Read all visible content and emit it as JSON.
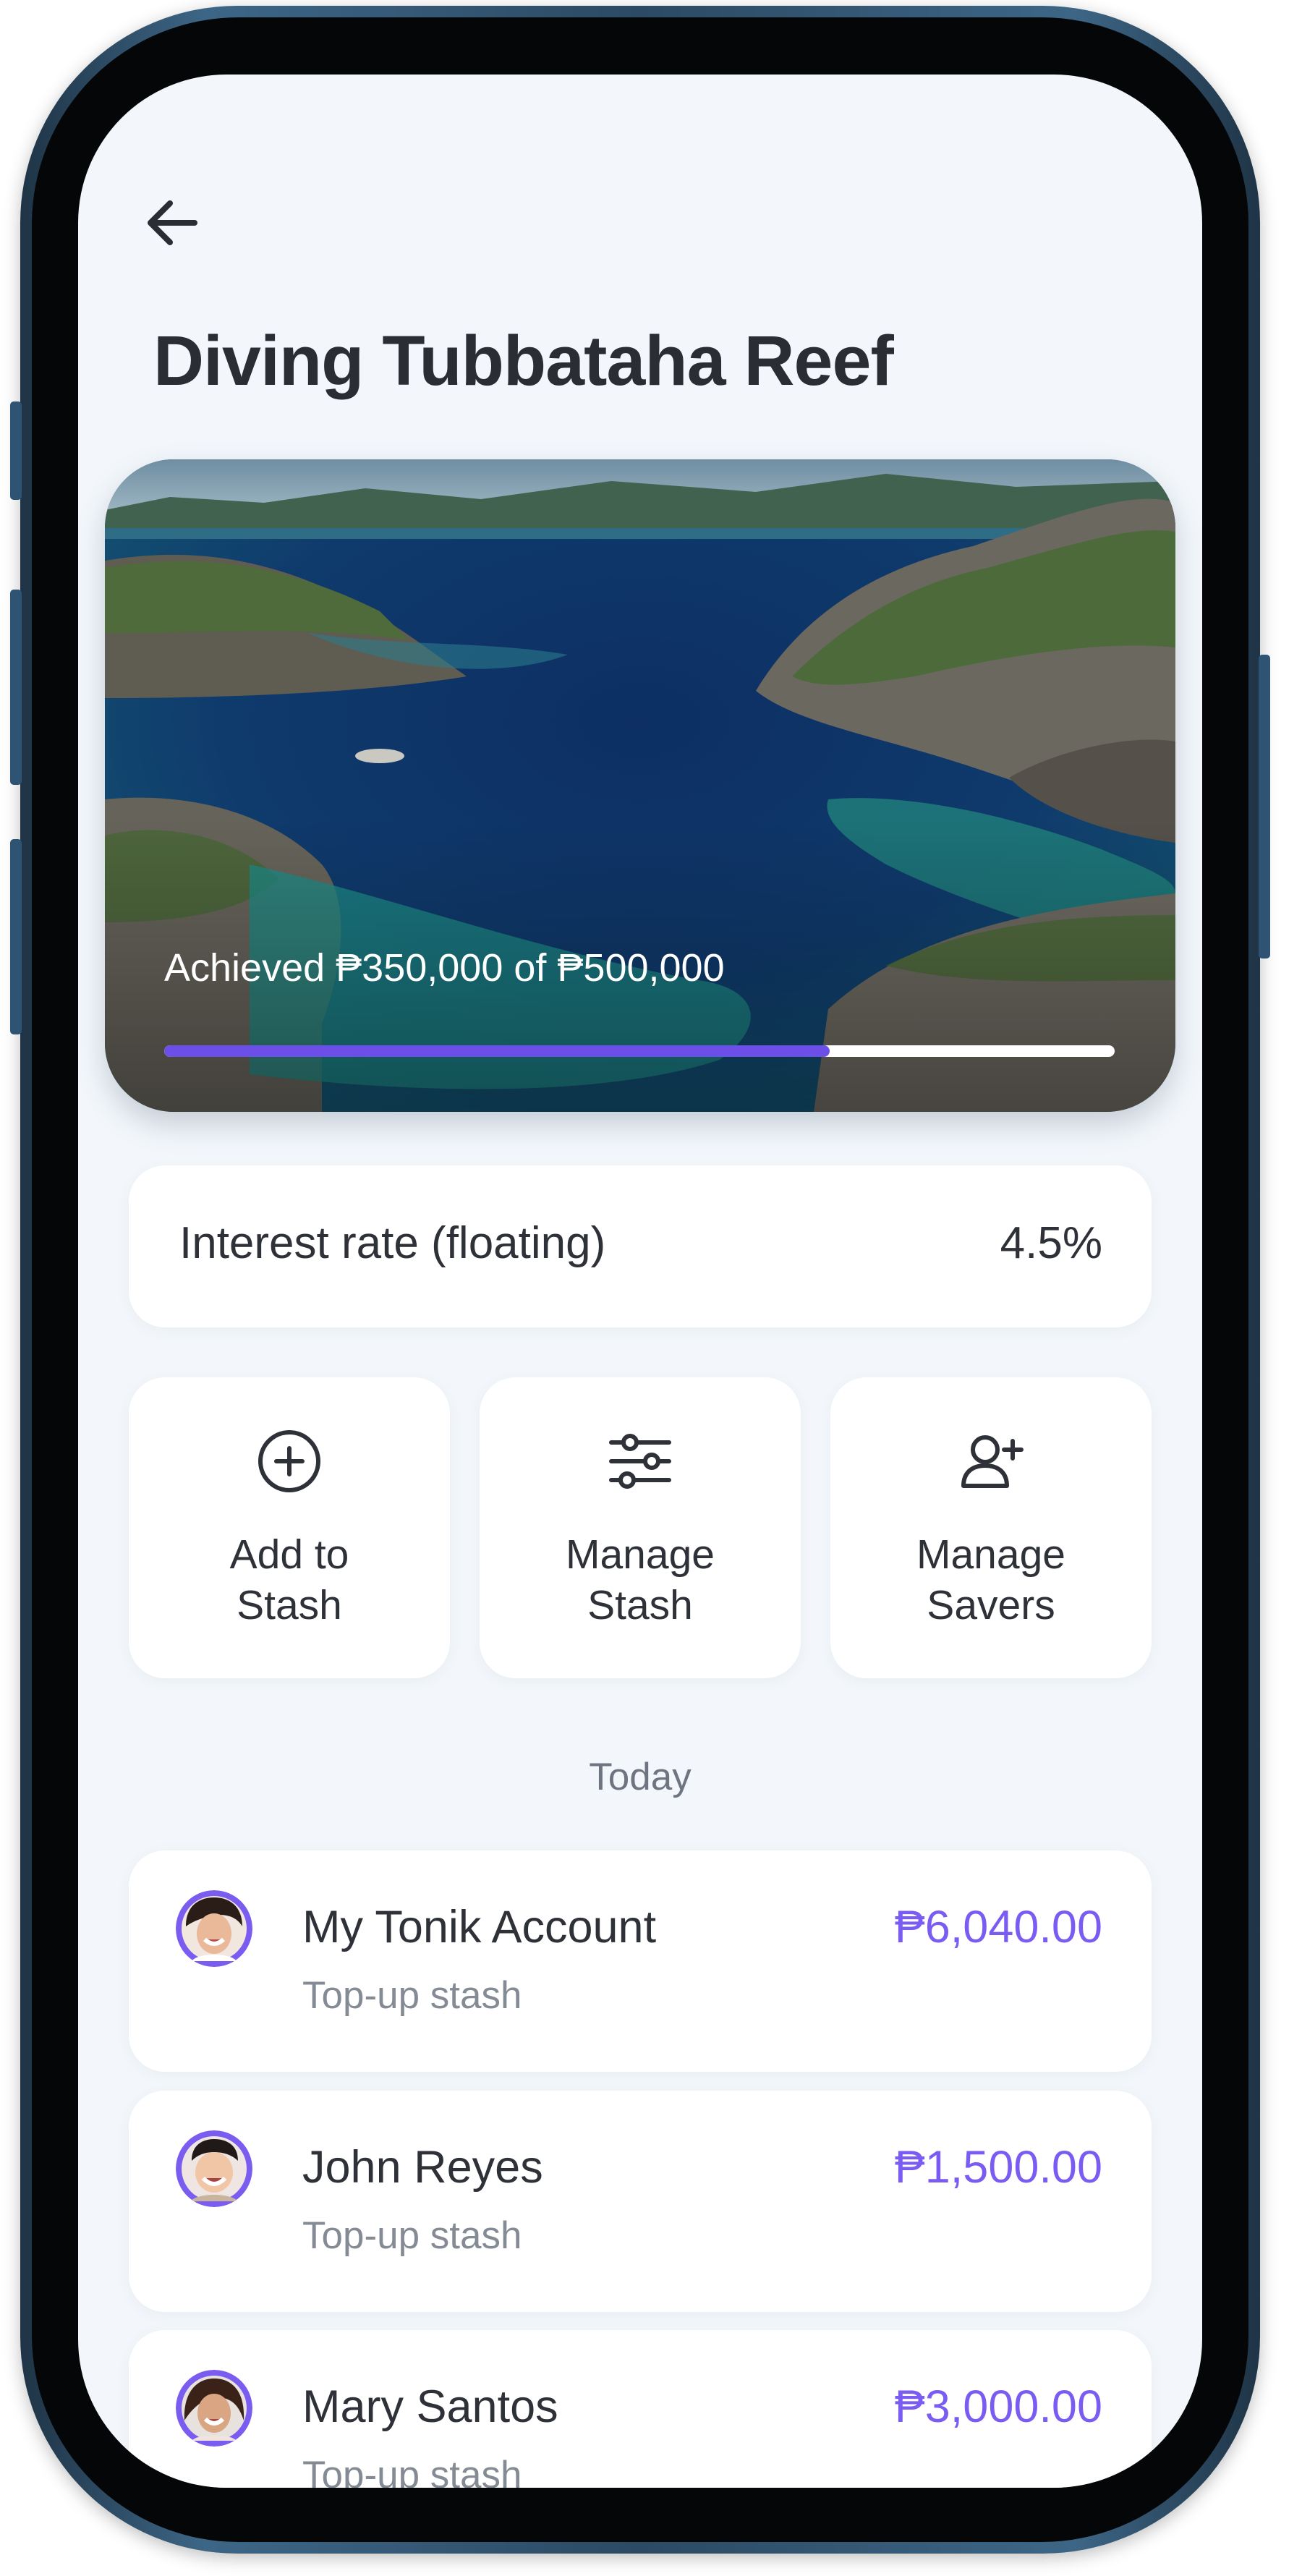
{
  "header": {
    "back_icon": "arrow-left-icon",
    "title": "Diving Tubbataha Reef"
  },
  "goal": {
    "progress_text": "Achieved ₱350,000 of ₱500,000",
    "achieved": 350000,
    "target": 500000,
    "progress_fraction": 0.7,
    "accent_color": "#6b4fe8"
  },
  "interest": {
    "label": "Interest rate (floating)",
    "value": "4.5%"
  },
  "actions": [
    {
      "label": "Add to\nStash",
      "icon": "plus-circle-icon"
    },
    {
      "label": "Manage\nStash",
      "icon": "sliders-icon"
    },
    {
      "label": "Manage\nSavers",
      "icon": "user-plus-icon"
    }
  ],
  "section_label": "Today",
  "transactions": [
    {
      "name": "My Tonik Account",
      "subtitle": "Top-up stash",
      "amount": "₱6,040.00"
    },
    {
      "name": "John Reyes",
      "subtitle": "Top-up stash",
      "amount": "₱1,500.00"
    },
    {
      "name": "Mary Santos",
      "subtitle": "Top-up stash",
      "amount": "₱3,000.00"
    }
  ],
  "colors": {
    "background": "#f3f7fb",
    "amount": "#7a5cf2",
    "avatar_ring": "#7b5cf0"
  }
}
